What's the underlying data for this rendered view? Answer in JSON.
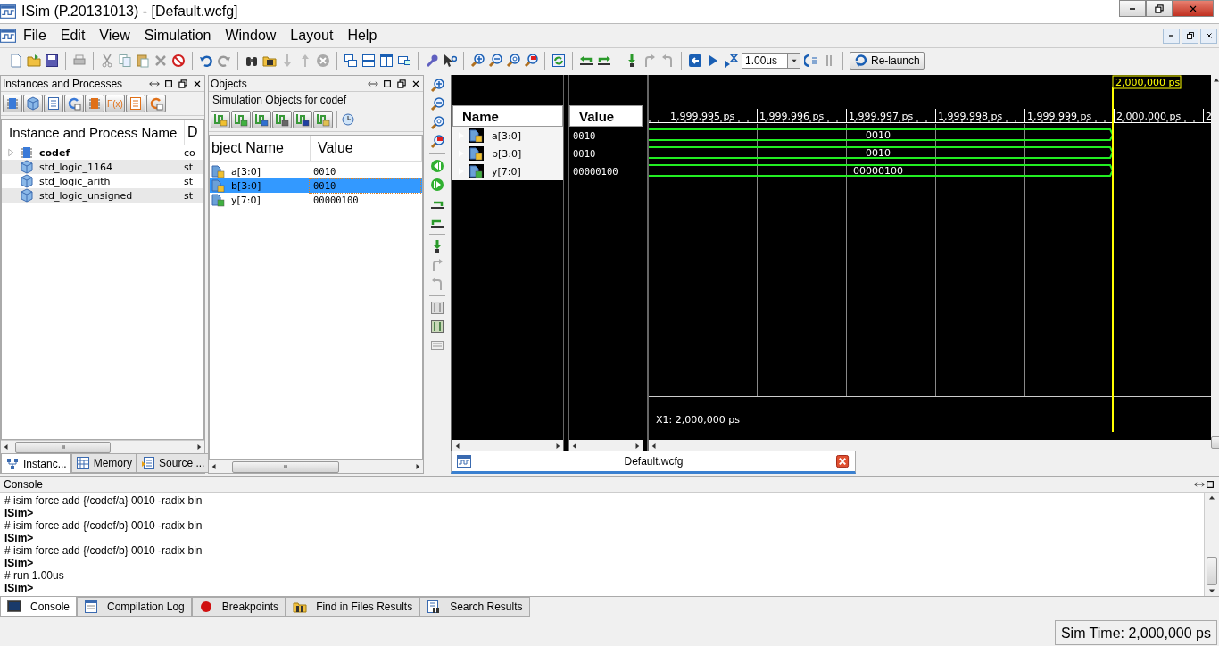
{
  "window": {
    "title": "ISim (P.20131013) - [Default.wcfg]"
  },
  "menu": [
    "File",
    "Edit",
    "View",
    "Simulation",
    "Window",
    "Layout",
    "Help"
  ],
  "toolbar": {
    "run_time": "1.00us",
    "relaunch": "Re-launch"
  },
  "instances_panel": {
    "title": "Instances and Processes",
    "function_button": "F(x)",
    "columns": [
      "Instance and Process Name",
      "D"
    ],
    "rows": [
      {
        "name": "codef",
        "design": "co",
        "kind": "module",
        "expanded": false
      },
      {
        "name": "std_logic_1164",
        "design": "st",
        "kind": "package"
      },
      {
        "name": "std_logic_arith",
        "design": "st",
        "kind": "package"
      },
      {
        "name": "std_logic_unsigned",
        "design": "st",
        "kind": "package"
      }
    ],
    "tabs": [
      {
        "label": "Instanc...",
        "selected": true
      },
      {
        "label": "Memory",
        "selected": false
      },
      {
        "label": "Source ...",
        "selected": false
      }
    ]
  },
  "objects_panel": {
    "title": "Objects",
    "subtitle": "Simulation Objects for codef",
    "columns": [
      "bject Name",
      "Value"
    ],
    "rows": [
      {
        "name": "a[3:0]",
        "value": "0010",
        "kind": "input",
        "selected": false
      },
      {
        "name": "b[3:0]",
        "value": "0010",
        "kind": "input",
        "selected": true
      },
      {
        "name": "y[7:0]",
        "value": "00000100",
        "kind": "output",
        "selected": false
      }
    ]
  },
  "wave": {
    "name_header": "Name",
    "value_header": "Value",
    "cursor_label": "2,000,000 ps",
    "ticks": [
      "1,999,995 ps",
      "1,999,996 ps",
      "1,999,997 ps",
      "1,999,998 ps",
      "1,999,999 ps",
      "2,000,000 ps",
      "2"
    ],
    "rows": [
      {
        "name": "a[3:0]",
        "value": "0010",
        "wave_value": "0010",
        "kind": "input"
      },
      {
        "name": "b[3:0]",
        "value": "0010",
        "wave_value": "0010",
        "kind": "input"
      },
      {
        "name": "y[7:0]",
        "value": "00000100",
        "wave_value": "00000100",
        "kind": "output"
      }
    ],
    "x1_label": "X1: 2,000,000 ps",
    "tab": "Default.wcfg"
  },
  "console": {
    "title": "Console",
    "lines": [
      {
        "text": "# isim force add {/codef/a} 0010 -radix bin",
        "kind": "echo"
      },
      {
        "text": "ISim>",
        "kind": "prompt"
      },
      {
        "text": "# isim force add {/codef/b} 0010 -radix bin",
        "kind": "echo"
      },
      {
        "text": "ISim>",
        "kind": "prompt"
      },
      {
        "text": "# isim force add {/codef/b} 0010 -radix bin",
        "kind": "echo"
      },
      {
        "text": "ISim>",
        "kind": "prompt"
      },
      {
        "text": "# run 1.00us",
        "kind": "echo"
      },
      {
        "text": "ISim>",
        "kind": "prompt"
      }
    ],
    "tabs": [
      {
        "label": "Console",
        "kind": "console",
        "selected": true
      },
      {
        "label": "Compilation Log",
        "kind": "log",
        "selected": false
      },
      {
        "label": "Breakpoints",
        "kind": "breakpoint",
        "selected": false
      },
      {
        "label": "Find in Files Results",
        "kind": "find",
        "selected": false
      },
      {
        "label": "Search Results",
        "kind": "search",
        "selected": false
      }
    ]
  },
  "status_bar": {
    "sim_time": "Sim Time: 2,000,000 ps"
  }
}
